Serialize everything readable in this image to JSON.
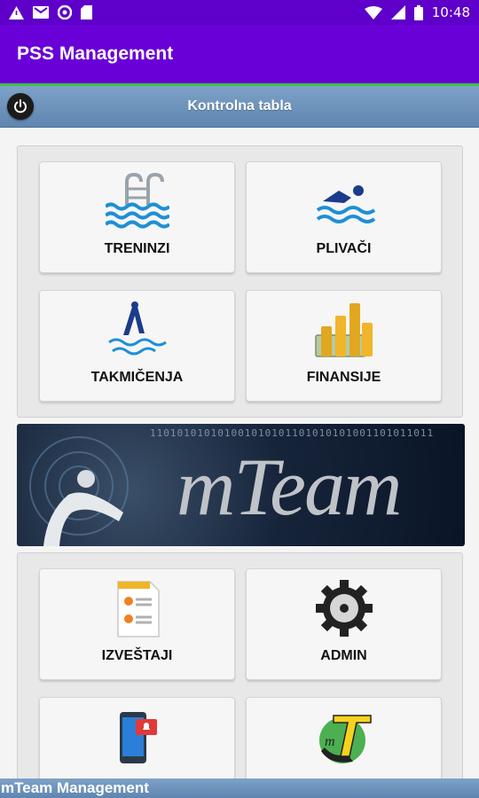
{
  "status_bar": {
    "time": "10:48",
    "icons": [
      "warning-icon",
      "gmail-icon",
      "circle-icon",
      "sd-card-icon",
      "wifi-icon",
      "signal-icon",
      "battery-icon"
    ]
  },
  "app": {
    "title": "PSS Management"
  },
  "subheader": {
    "title": "Kontrolna tabla",
    "power_icon": "power-icon"
  },
  "panel1": {
    "tiles": [
      {
        "label": "TRENINZI",
        "icon": "pool-ladder-icon"
      },
      {
        "label": "PLIVAČI",
        "icon": "swimmer-icon"
      },
      {
        "label": "TAKMIČENJA",
        "icon": "diver-icon"
      },
      {
        "label": "FINANSIJE",
        "icon": "coins-money-icon"
      }
    ]
  },
  "banner": {
    "text": "mTeam",
    "bits": "110101010101001010101101010101001101011011"
  },
  "panel2": {
    "tiles": [
      {
        "label": "IZVEŠTAJI",
        "icon": "report-document-icon"
      },
      {
        "label": "ADMIN",
        "icon": "gear-icon"
      },
      {
        "label": "",
        "icon": "phone-notification-icon"
      },
      {
        "label": "",
        "icon": "mteam-logo-icon"
      }
    ]
  },
  "footer": {
    "text": "mTeam Management"
  },
  "colors": {
    "status_bar": "#5e00c9",
    "app_bar": "#6a00d8",
    "accent_line": "#3ec23e",
    "subheader": "#6f94bc"
  }
}
